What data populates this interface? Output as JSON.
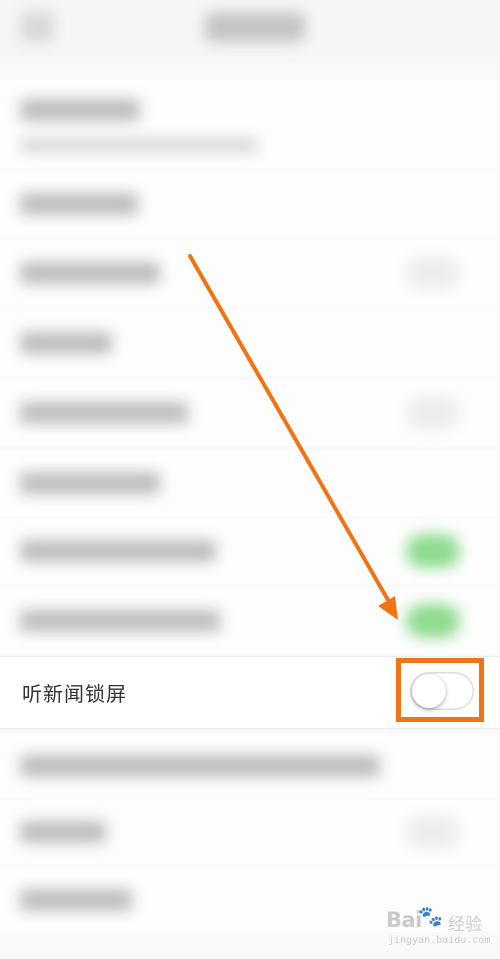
{
  "settings": {
    "highlighted_item": {
      "label": "听新闻锁屏",
      "toggle_on": false
    }
  },
  "annotation": {
    "color": "#f07416",
    "target": "听新闻锁屏 toggle"
  },
  "watermark": {
    "brand": "Bai",
    "brand_suffix": "经验",
    "url": "jingyan.baidu.com"
  },
  "icons": {
    "back": "back-arrow-icon",
    "paw": "baidu-paw-icon"
  },
  "colors": {
    "toggle_on_green": "#8fdc8f",
    "background": "#f9f9f9"
  }
}
